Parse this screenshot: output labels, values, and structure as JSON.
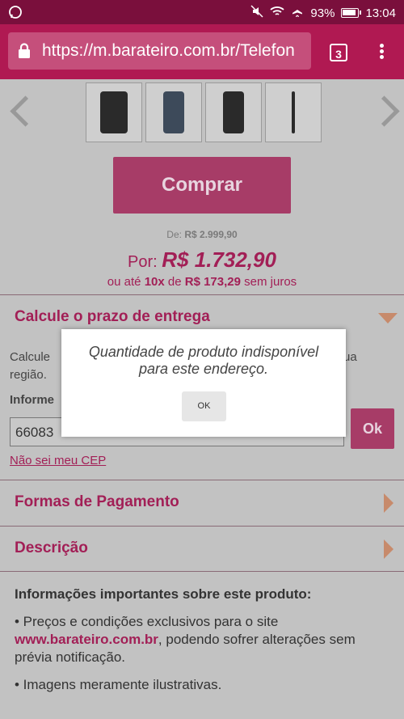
{
  "status_bar": {
    "battery": "93%",
    "battery_level": 0.93,
    "time": "13:04"
  },
  "browser": {
    "url": "https://m.barateiro.com.br/Telefon",
    "tab_count": "3"
  },
  "product": {
    "buy_label": "Comprar",
    "old_price_prefix": "De:",
    "old_price": "R$ 2.999,90",
    "price_prefix": "Por:",
    "price": "R$ 1.732,90",
    "installment_prefix": "ou até",
    "installment_count": "10x",
    "installment_mid": "de",
    "installment_value": "R$ 173,29",
    "installment_suffix": "sem juros"
  },
  "delivery": {
    "title": "Calcule o prazo de entrega",
    "text_line1_start": "Calcule",
    "text_line1_end": "ua",
    "text_line2": "região.",
    "label": "Informe",
    "cep_value": "66083",
    "ok_label": "Ok",
    "cep_link": "Não sei meu CEP"
  },
  "sections": {
    "payment": "Formas de Pagamento",
    "description": "Descrição"
  },
  "info": {
    "heading": "Informações importantes sobre este produto:",
    "bullet1_start": "• Preços e condições exclusivos para o site",
    "bullet1_link": "www.barateiro.com.br",
    "bullet1_end": ", podendo sofrer alterações sem prévia notificação.",
    "bullet2": "• Imagens meramente ilustrativas."
  },
  "dialog": {
    "message_line1": "Quantidade de produto indisponível",
    "message_line2": "para este endereço.",
    "ok_label": "OK"
  },
  "colors": {
    "brand": "#b01952",
    "status_bar": "#7a0f3c",
    "price_text": "#a21f56"
  }
}
